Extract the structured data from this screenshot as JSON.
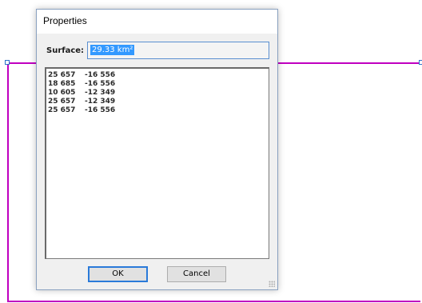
{
  "dialog": {
    "title": "Properties",
    "surface_label": "Surface:",
    "surface_value": "29.33 km²",
    "coordinates": [
      {
        "x": "25 657",
        "y": "-16 556"
      },
      {
        "x": "18 685",
        "y": "-16 556"
      },
      {
        "x": "10 605",
        "y": "-12 349"
      },
      {
        "x": "25 657",
        "y": "-12 349"
      },
      {
        "x": "25 657",
        "y": "-16 556"
      }
    ],
    "ok_label": "OK",
    "cancel_label": "Cancel"
  },
  "colors": {
    "polygon_stroke": "#c000c0",
    "selection_highlight": "#3399ff",
    "handle_border": "#2a72c9"
  }
}
